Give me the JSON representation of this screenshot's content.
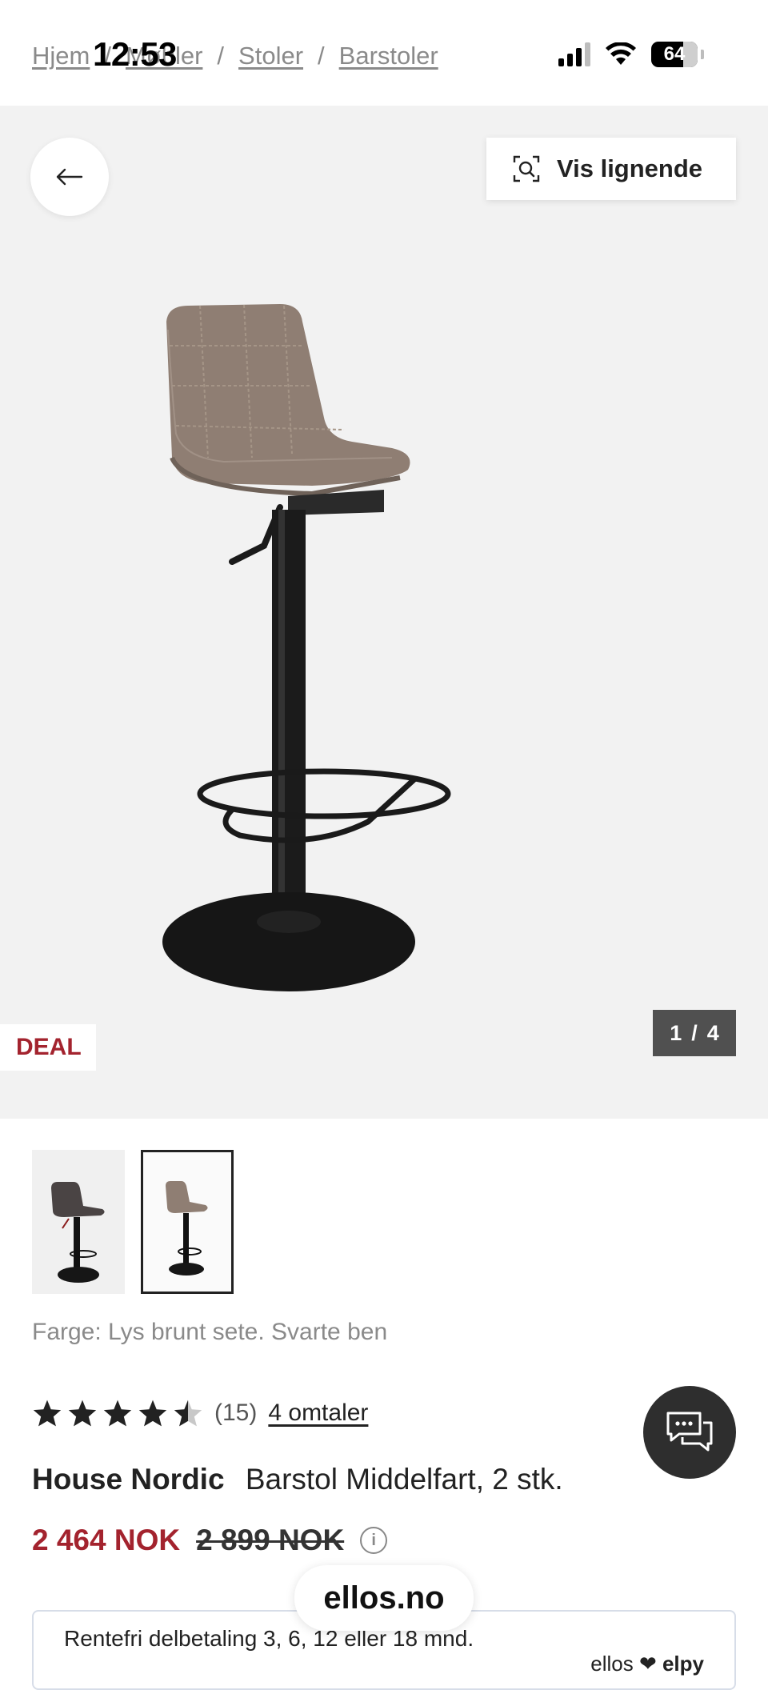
{
  "status_bar": {
    "time": "12:53",
    "battery": "64"
  },
  "breadcrumb": {
    "items": [
      "Hjem",
      "Møbler",
      "Stoler",
      "Barstoler"
    ],
    "separator": "/"
  },
  "gallery": {
    "back_icon": "arrow-left-icon",
    "similar_label": "Vis lignende",
    "similar_icon": "visual-search-icon",
    "badge": "DEAL",
    "counter_current": "1",
    "counter_sep": "/",
    "counter_total": "4"
  },
  "thumbnails": [
    {
      "name": "thumbnail-dark-grey",
      "selected": false
    },
    {
      "name": "thumbnail-light-brown",
      "selected": true
    }
  ],
  "product": {
    "color_line": "Farge: Lys brunt sete. Svarte ben",
    "rating_value": 4.5,
    "rating_count": "(15)",
    "reviews_link": "4 omtaler",
    "brand": "House Nordic",
    "name": "Barstol Middelfart, 2 stk.",
    "price_now": "2 464 NOK",
    "price_old": "2 899 NOK"
  },
  "finance": {
    "text": "Rentefri delbetaling 3, 6, 12 eller 18 mnd.",
    "partner_a": "ellos",
    "partner_b": "elpy"
  },
  "url_pill": "ellos.no",
  "colors": {
    "accent_red": "#a3232e",
    "dark": "#2e2e2e",
    "gallery_bg": "#f2f2f2"
  }
}
